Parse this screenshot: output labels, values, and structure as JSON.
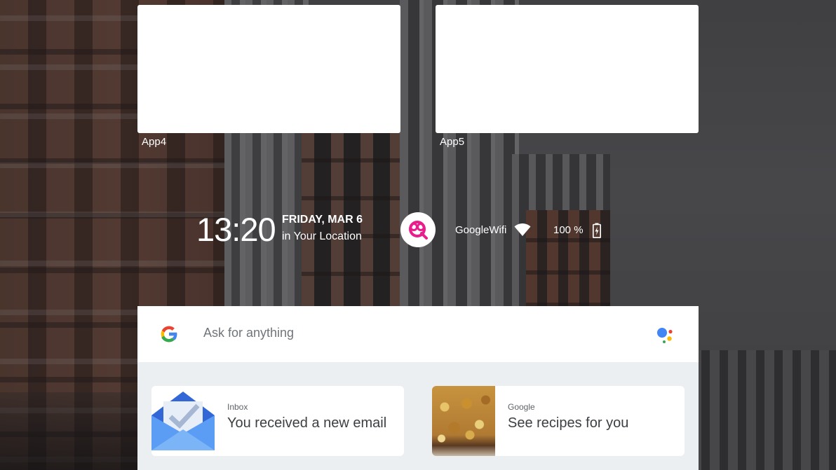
{
  "apps": [
    {
      "label": "App4"
    },
    {
      "label": "App5"
    }
  ],
  "status": {
    "time": "13:20",
    "date": "FRIDAY, MAR 6",
    "location": "in Your Location",
    "wifi_name": "GoogleWifi",
    "battery": "100 %"
  },
  "search": {
    "placeholder": "Ask for anything"
  },
  "suggestions": [
    {
      "source": "Inbox",
      "title": "You received a new email",
      "icon": "inbox-icon"
    },
    {
      "source": "Google",
      "title": "See recipes for you",
      "icon": "recipe-image"
    }
  ],
  "colors": {
    "google_blue": "#4285F4",
    "google_red": "#EA4335",
    "google_yellow": "#FBBC05",
    "google_green": "#34A853",
    "profile_pink": "#e91e8c"
  }
}
